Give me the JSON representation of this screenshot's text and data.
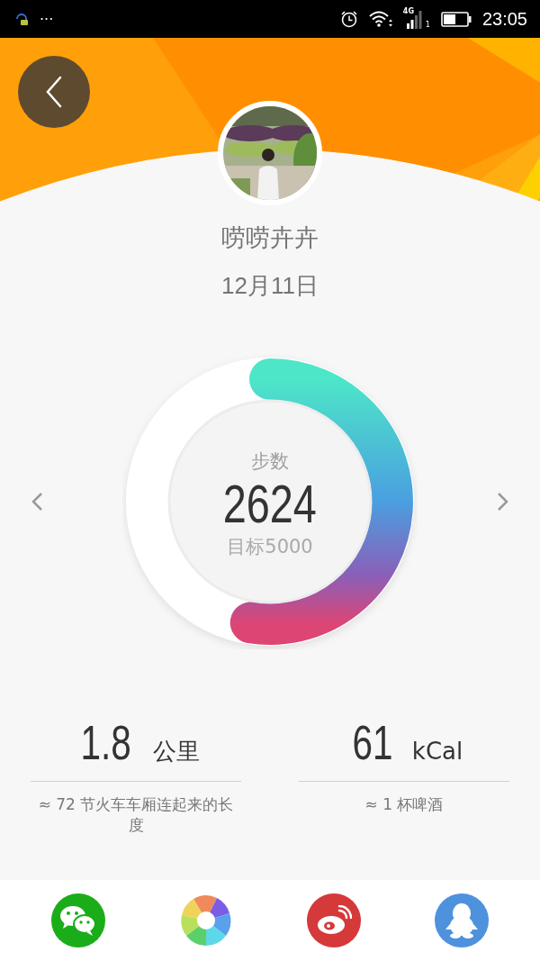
{
  "status_bar": {
    "notification": "···",
    "network": "4G",
    "sim": "1",
    "time": "23:05"
  },
  "profile": {
    "name": "唠唠卉卉",
    "date": "12月11日"
  },
  "steps": {
    "label": "步数",
    "value": "2624",
    "goal": "目标5000"
  },
  "stats": [
    {
      "value": "1.8",
      "unit": "公里",
      "note": "≈ 72  节火车车厢连起来的长度"
    },
    {
      "value": "61",
      "unit": "kCal",
      "note": "≈ 1 杯啤酒"
    }
  ],
  "share": [
    {
      "kind": "wechat"
    },
    {
      "kind": "aperture"
    },
    {
      "kind": "weibo"
    },
    {
      "kind": "qq"
    }
  ]
}
